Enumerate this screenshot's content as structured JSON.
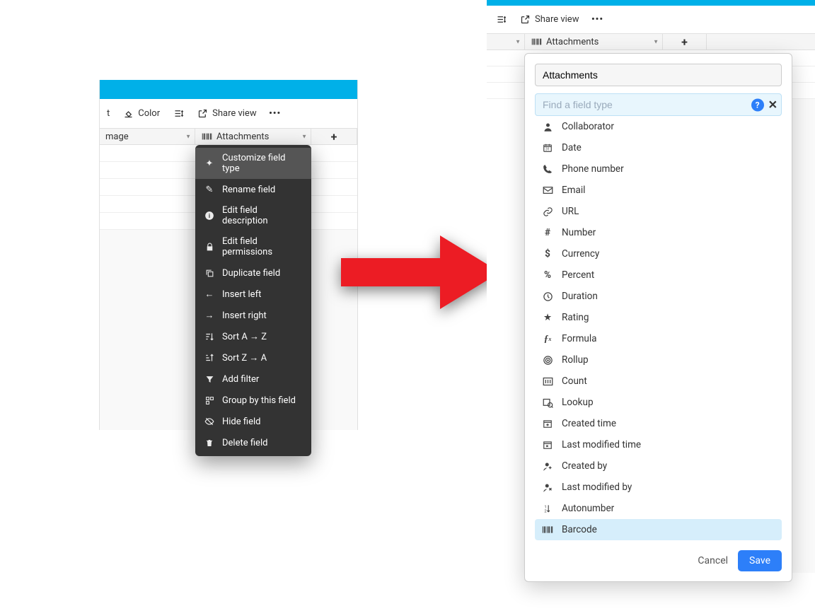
{
  "left": {
    "toolbar": {
      "t": "t",
      "color": "Color",
      "row_height": "",
      "share": "Share view",
      "more": "…"
    },
    "columns": {
      "mage": "mage",
      "att": "Attachments"
    },
    "ctx": {
      "customize": "Customize field type",
      "rename": "Rename field",
      "desc": "Edit field description",
      "perms": "Edit field permissions",
      "dup": "Duplicate field",
      "ileft": "Insert left",
      "iright": "Insert right",
      "sortaz": "Sort A → Z",
      "sortza": "Sort Z → A",
      "filter": "Add filter",
      "group": "Group by this field",
      "hide": "Hide field",
      "del": "Delete field"
    }
  },
  "right": {
    "toolbar": {
      "row_height": "",
      "share": "Share view",
      "more": "…"
    },
    "columns": {
      "att": "Attachments"
    },
    "popover": {
      "rename_value": "Attachments",
      "search_placeholder": "Find a field type",
      "types": {
        "collab": "Collaborator",
        "date": "Date",
        "phone": "Phone number",
        "email": "Email",
        "url": "URL",
        "number": "Number",
        "currency": "Currency",
        "percent": "Percent",
        "duration": "Duration",
        "rating": "Rating",
        "formula": "Formula",
        "rollup": "Rollup",
        "count": "Count",
        "lookup": "Lookup",
        "created_time": "Created time",
        "modified_time": "Last modified time",
        "created_by": "Created by",
        "modified_by": "Last modified by",
        "autonumber": "Autonumber",
        "barcode": "Barcode"
      },
      "cancel": "Cancel",
      "save": "Save"
    }
  },
  "colors": {
    "accent": "#00b0e8",
    "primary": "#2d7ff9",
    "arrow": "#ec1c24"
  }
}
